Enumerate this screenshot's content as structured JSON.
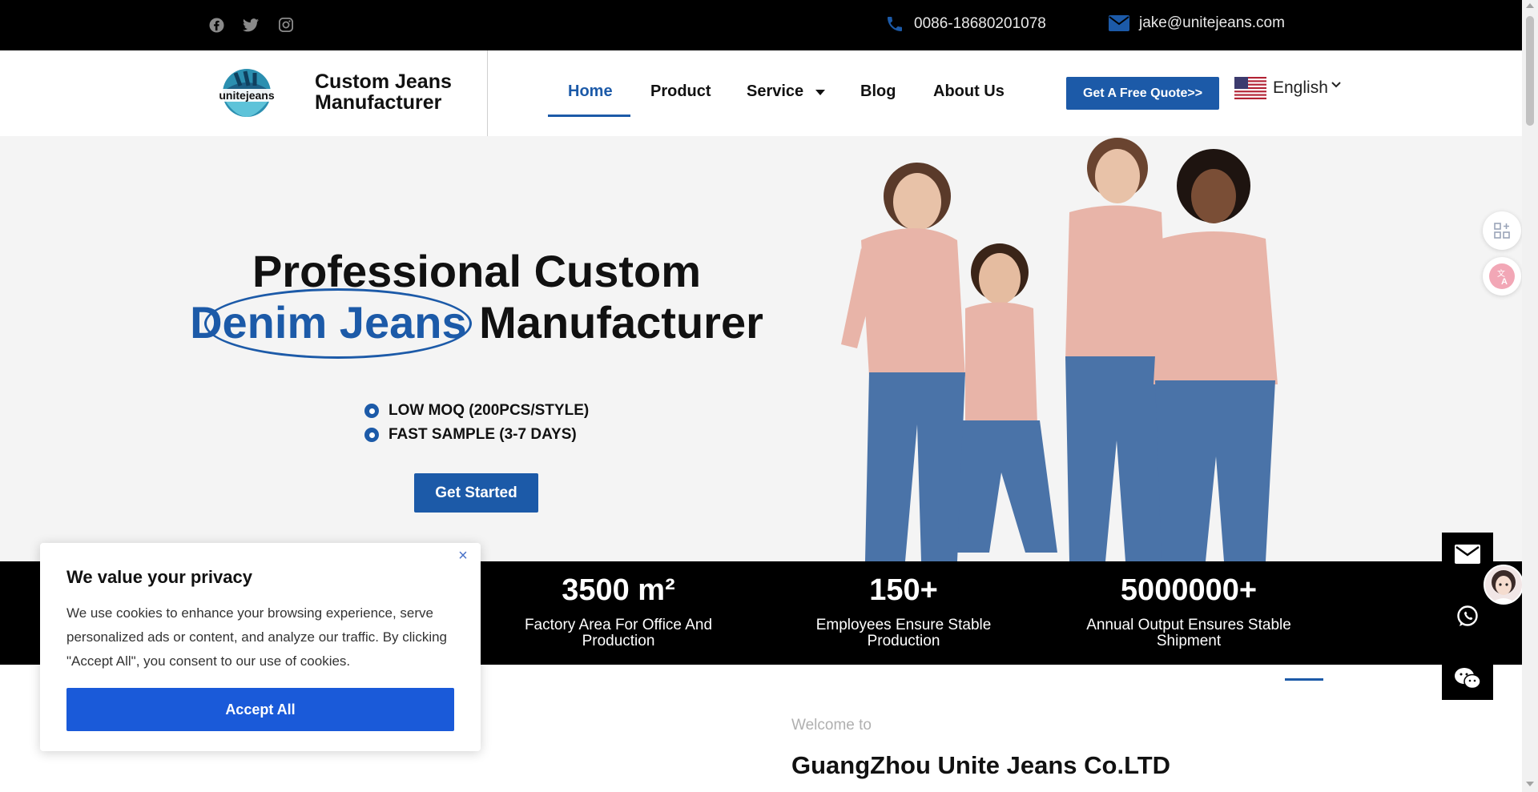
{
  "topbar": {
    "social": [
      "facebook-icon",
      "twitter-icon",
      "instagram-icon"
    ],
    "phone": "0086-18680201078",
    "email": "jake@unitejeans.com"
  },
  "header": {
    "logo_text": "unitejeans",
    "brand_line1": "Custom Jeans",
    "brand_line2": "Manufacturer",
    "nav": [
      "Home",
      "Product",
      "Service",
      "Blog",
      "About Us"
    ],
    "active_nav": "Home",
    "quote_button": "Get A Free Quote>>",
    "language": "English"
  },
  "hero": {
    "title_line1": "Professional Custom",
    "title_accent": "Denim Jeans",
    "title_rest": "Manufacturer",
    "bullets": [
      "LOW MOQ (200PCS/STYLE)",
      "FAST SAMPLE (3-7 DAYS)"
    ],
    "cta": "Get Started"
  },
  "stats": [
    {
      "value": "3500 m²",
      "label": "Factory Area For Office And Production"
    },
    {
      "value": "150+",
      "label": "Employees Ensure Stable Production"
    },
    {
      "value": "5000000+",
      "label": "Annual Output Ensures Stable Shipment"
    }
  ],
  "about": {
    "welcome": "Welcome to",
    "company": "GuangZhou Unite Jeans Co.LTD"
  },
  "cookie": {
    "title": "We value your privacy",
    "text": "We use cookies to enhance your browsing experience, serve personalized ads or content, and analyze our traffic. By clicking \"Accept All\", you consent to our use of cookies.",
    "accept": "Accept All",
    "close": "×"
  },
  "colors": {
    "accent": "#1c5aa8",
    "cookie_button": "#1a5ad9",
    "topbar": "#000000",
    "hero_bg": "#f4f4f4",
    "shirt": "#e8b4a8",
    "denim": "#4a73a8"
  }
}
